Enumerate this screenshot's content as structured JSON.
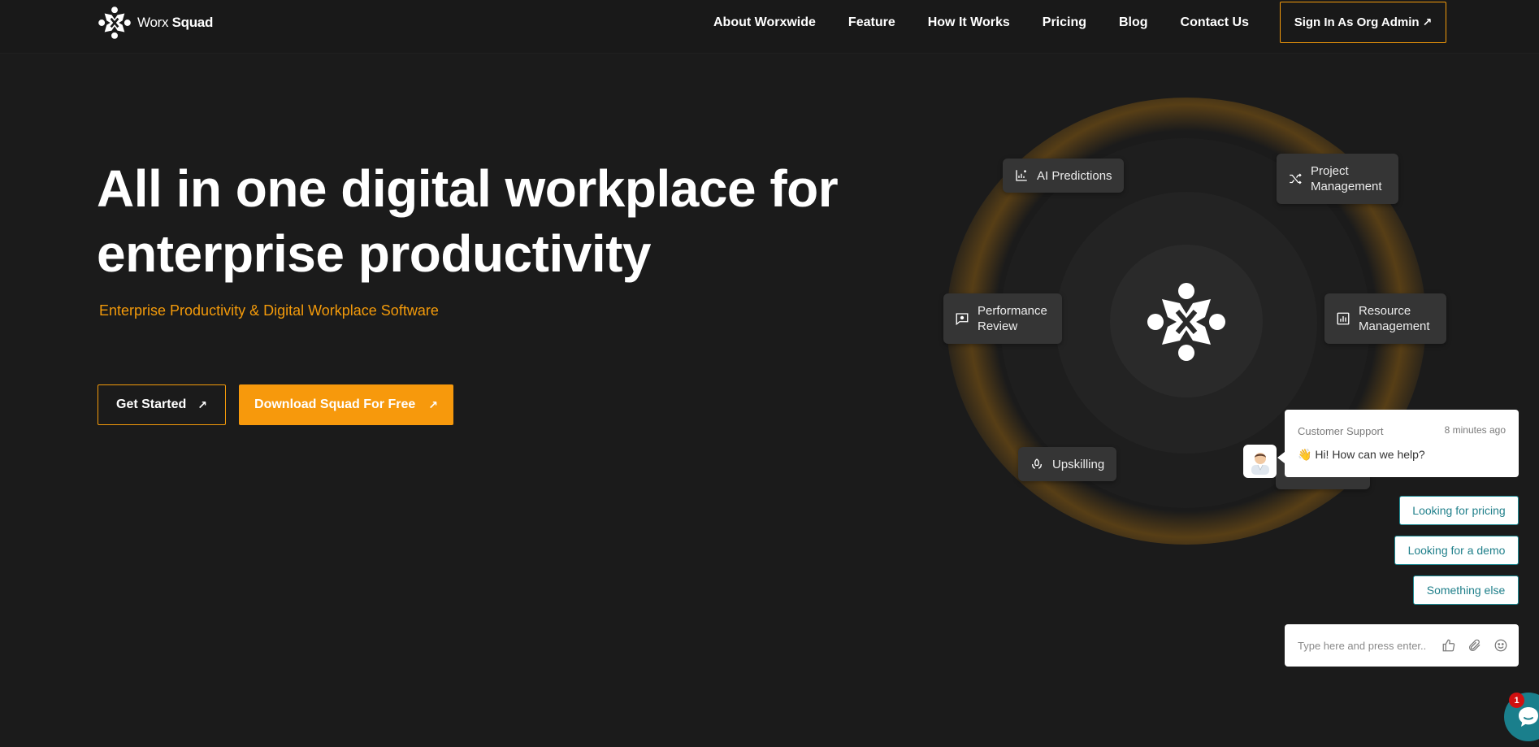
{
  "brand": {
    "name_light": "Worx",
    "name_bold": "Squad"
  },
  "nav": {
    "items": [
      "About Worxwide",
      "Feature",
      "How It Works",
      "Pricing",
      "Blog",
      "Contact Us"
    ],
    "admin_label": "Sign In As Org Admin",
    "admin_arrow": "↗"
  },
  "hero": {
    "title": "All in one digital workplace for enterprise productivity",
    "subtitle": "Enterprise Productivity & Digital Workplace Software",
    "get_started": "Get Started",
    "download": "Download Squad For Free",
    "arrow": "↗"
  },
  "orbit": {
    "ai_predictions": "AI Predictions",
    "project_management": "Project Management",
    "performance_review": "Performance Review",
    "resource_management": "Resource Management",
    "upskilling": "Upskilling"
  },
  "chat": {
    "from": "Customer Support",
    "time": "8 minutes ago",
    "message": "👋 Hi! How can we help?",
    "options": [
      "Looking for pricing",
      "Looking for a demo",
      "Something else"
    ],
    "input_placeholder": "Type here and press enter..",
    "badge_count": "1",
    "accent_color": "#1a7f8c"
  },
  "colors": {
    "brand_orange": "#f39a0a",
    "background": "#1b1b1b"
  },
  "icons": [
    "x-logo-icon",
    "arrow-up-right-icon",
    "chart-sparkle-icon",
    "shuffle-icon",
    "review-chat-icon",
    "bar-chart-icon",
    "rocket-cycle-icon",
    "agent-avatar-icon",
    "thumbs-up-icon",
    "paperclip-icon",
    "smiley-icon",
    "chat-bubble-icon"
  ]
}
